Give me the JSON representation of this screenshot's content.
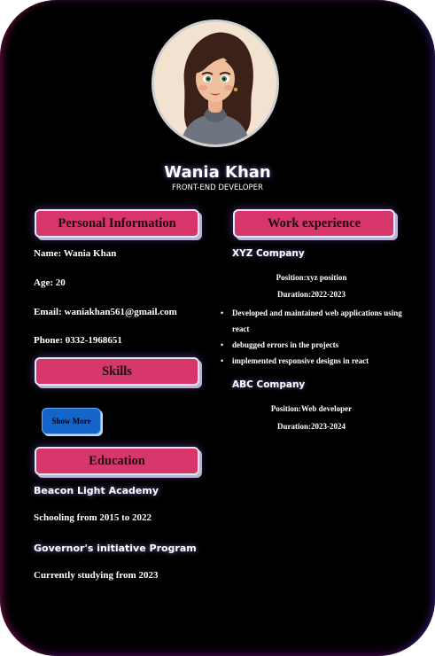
{
  "profile": {
    "name": "Wania Khan",
    "role": "FRONT-END DEVELOPER"
  },
  "personal": {
    "heading": "Personal Information",
    "name_line": "Name: Wania Khan",
    "age_line": "Age: 20",
    "email_line": "Email: waniakhan561@gmail.com",
    "phone_line": "Phone: 0332-1968651"
  },
  "skills": {
    "heading": "Skills",
    "show_more_label": "Show More"
  },
  "education": {
    "heading": "Education",
    "items": [
      {
        "title": "Beacon Light Academy",
        "detail": "Schooling from 2015 to 2022"
      },
      {
        "title": "Governor's initiative Program",
        "detail": "Currently studying from 2023"
      }
    ]
  },
  "work": {
    "heading": "Work experience",
    "jobs": [
      {
        "company": "XYZ Company",
        "position": "Position:xyz position",
        "duration": "Duration:2022-2023",
        "bullets": [
          "Developed and maintained web applications using react",
          "debugged errors in the projects",
          "implemented responsive designs in react"
        ]
      },
      {
        "company": "ABC Company",
        "position": "Position:Web developer",
        "duration": "Duration:2023-2024"
      }
    ]
  },
  "colors": {
    "background": "#000000",
    "header_fill": "#d6366a",
    "button_fill": "#1565c8"
  }
}
